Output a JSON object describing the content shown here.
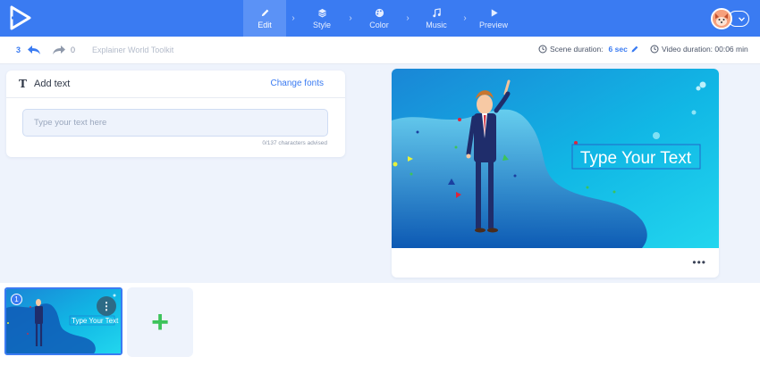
{
  "topbar": {
    "steps": [
      {
        "label": "Edit",
        "icon": "pencil-icon",
        "active": true
      },
      {
        "label": "Style",
        "icon": "layers-icon",
        "active": false
      },
      {
        "label": "Color",
        "icon": "palette-icon",
        "active": false
      },
      {
        "label": "Music",
        "icon": "music-note-icon",
        "active": false
      },
      {
        "label": "Preview",
        "icon": "play-icon",
        "active": false
      }
    ],
    "separator": "›",
    "colors": {
      "primary": "#3a7bf2",
      "active_step": "#5b92f6"
    }
  },
  "subbar": {
    "undo_count": "3",
    "redo_count": "0",
    "project_name": "Explainer World Toolkit",
    "scene_duration_label": "Scene duration:",
    "scene_duration_value": "6 sec",
    "video_duration_label": "Video duration: 00:06 min"
  },
  "text_panel": {
    "title": "Add text",
    "title_icon": "T",
    "change_fonts": "Change fonts",
    "input_value": "",
    "input_placeholder": "Type your text here",
    "char_count": "0/137 characters advised"
  },
  "preview": {
    "canvas_text": "Type Your Text",
    "menu": "•••"
  },
  "timeline": {
    "scenes": [
      {
        "number": "1",
        "text": "Type Your Text",
        "menu": "⋮"
      }
    ],
    "add_scene": "+"
  }
}
